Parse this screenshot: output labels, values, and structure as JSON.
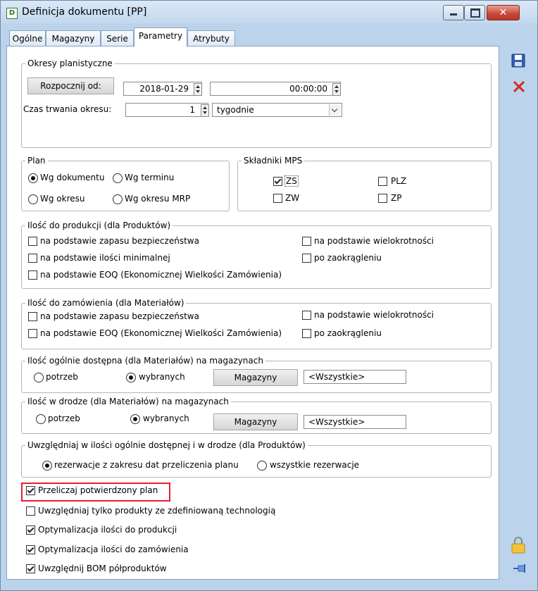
{
  "window": {
    "title": "Definicja dokumentu [PP]"
  },
  "tabs": [
    {
      "label": "Ogólne"
    },
    {
      "label": "Magazyny"
    },
    {
      "label": "Serie"
    },
    {
      "label": "Parametry"
    },
    {
      "label": "Atrybuty"
    }
  ],
  "okresy": {
    "legend": "Okresy planistyczne",
    "start_button": "Rozpocznij od:",
    "start_date": "2018-01-29",
    "start_time": "00:00:00",
    "duration_label": "Czas trwania okresu:",
    "duration_value": "1",
    "duration_unit": "tygodnie"
  },
  "plan": {
    "legend": "Plan",
    "options": [
      "Wg dokumentu",
      "Wg terminu",
      "Wg okresu",
      "Wg okresu MRP"
    ],
    "selected": "Wg dokumentu"
  },
  "mps": {
    "legend": "Składniki MPS",
    "items": [
      {
        "label": "ZS",
        "checked": true
      },
      {
        "label": "PLZ",
        "checked": false
      },
      {
        "label": "ZW",
        "checked": false
      },
      {
        "label": "ZP",
        "checked": false
      }
    ]
  },
  "produkcja": {
    "legend": "Ilość do produkcji (dla Produktów)",
    "items": [
      {
        "label": "na podstawie zapasu bezpieczeństwa",
        "checked": false
      },
      {
        "label": "na podstawie ilości minimalnej",
        "checked": false
      },
      {
        "label": "na podstawie EOQ (Ekonomicznej Wielkości Zamówienia)",
        "checked": false
      },
      {
        "label": "na podstawie wielokrotności",
        "checked": false
      },
      {
        "label": "po zaokrągleniu",
        "checked": false
      }
    ]
  },
  "zamowienie": {
    "legend": "Ilość do zamówienia (dla Materiałów)",
    "items": [
      {
        "label": "na podstawie zapasu bezpieczeństwa",
        "checked": false
      },
      {
        "label": "na podstawie EOQ (Ekonomicznej Wielkości Zamówienia)",
        "checked": false
      },
      {
        "label": "na podstawie wielokrotności",
        "checked": false
      },
      {
        "label": "po zaokrągleniu",
        "checked": false
      }
    ]
  },
  "dostepna": {
    "legend": "Ilość ogólnie dostępna (dla Materiałów) na magazynach",
    "opt1": "potrzeb",
    "opt2": "wybranych",
    "selected": "wybranych",
    "button": "Magazyny",
    "value": "<Wszystkie>"
  },
  "wdrodze": {
    "legend": "Ilość w drodze (dla Materiałów) na magazynach",
    "opt1": "potrzeb",
    "opt2": "wybranych",
    "selected": "wybranych",
    "button": "Magazyny",
    "value": "<Wszystkie>"
  },
  "uwzgl": {
    "legend": "Uwzględniaj w ilości ogólnie dostępnej i w drodze (dla Produktów)",
    "opt1": "rezerwacje z zakresu dat przeliczenia planu",
    "opt2": "wszystkie rezerwacje",
    "selected": "rezerwacje z zakresu dat przeliczenia planu"
  },
  "options": [
    {
      "label": "Przeliczaj potwierdzony plan",
      "checked": true
    },
    {
      "label": "Uwzględniaj tylko produkty ze zdefiniowaną technologią",
      "checked": false
    },
    {
      "label": "Optymalizacja ilości do produkcji",
      "checked": true
    },
    {
      "label": "Optymalizacja ilości do zamówienia",
      "checked": true
    },
    {
      "label": "Uwzględnij BOM półproduktów",
      "checked": true
    }
  ],
  "colors": {
    "highlight": "#e4202b",
    "save_icon": "#2f5fb3",
    "delete_icon": "#d62a1e"
  },
  "icons": [
    "save-icon",
    "delete-icon",
    "lock-icon",
    "pin-icon"
  ]
}
